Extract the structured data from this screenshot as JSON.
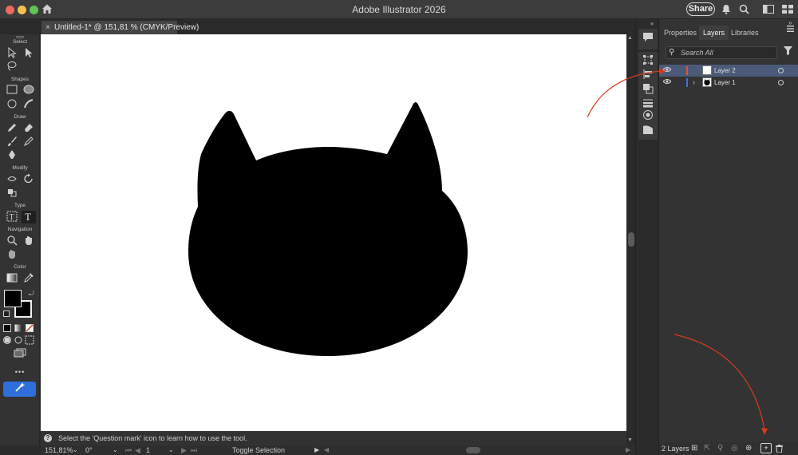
{
  "window": {
    "app_title": "Adobe Illustrator 2026",
    "share_label": "Share"
  },
  "tab": {
    "title": "Untitled-1* @ 151,81 % (CMYK/Preview)",
    "close": "×"
  },
  "toolbar": {
    "sections": {
      "select": "Select",
      "shapes": "Shapes",
      "draw": "Draw",
      "modify": "Modify",
      "type": "Type",
      "navigation": "Navigation",
      "color": "Color"
    },
    "more": "•••"
  },
  "hint": {
    "text": "Select the 'Question mark' icon to learn how to use the tool.",
    "icon": "?"
  },
  "status": {
    "zoom": "151,81%",
    "rotation": "0°",
    "artboard_number": "1",
    "toggle": "Toggle Selection"
  },
  "panel": {
    "tabs": [
      "Properties",
      "Layers",
      "Libraries"
    ],
    "active_tab": "Layers",
    "search_placeholder": "Search All",
    "layers": [
      {
        "name": "Layer 2",
        "color": "#e2552d",
        "selected": true,
        "thumbnail": "blank"
      },
      {
        "name": "Layer 1",
        "color": "#4a6fd6",
        "selected": false,
        "thumbnail": "cat-head"
      }
    ],
    "footer": {
      "count_label": "2 Layers"
    }
  },
  "artwork": {
    "fill": "#000000",
    "description_colors": {
      "canvas": "#ffffff"
    }
  },
  "colors": {
    "accent_blue": "#2f6fdc",
    "annotation_red": "#d63b1f"
  }
}
